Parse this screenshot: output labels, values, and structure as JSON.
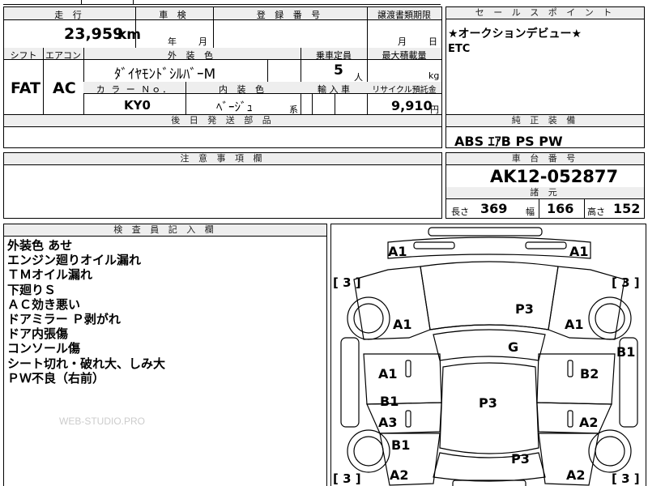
{
  "mileage": {
    "header": "走 行",
    "value": "23,959",
    "unit": "km"
  },
  "inspection": {
    "header": "車 検",
    "year_unit": "年",
    "month_unit": "月"
  },
  "registration": {
    "header": "登 録 番 号"
  },
  "transfer_docs": {
    "header": "譲渡書類期限",
    "month_unit": "月",
    "day_unit": "日"
  },
  "shift": {
    "header": "シフト",
    "value": "FAT"
  },
  "aircon": {
    "header": "エアコン",
    "value": "AC"
  },
  "exterior_color": {
    "header": "外 装 色",
    "value": "ﾀﾞｲﾔﾓﾝﾄﾞｼﾙﾊﾞｰM"
  },
  "capacity": {
    "header": "乗車定員",
    "value": "5",
    "unit": "人"
  },
  "max_load": {
    "header": "最大積載量",
    "unit": "kg"
  },
  "color_no": {
    "header": "カ ラ ー Ｎｏ．",
    "value": "KY0"
  },
  "interior_color": {
    "header": "内 装 色",
    "value": "ﾍﾞｰｼﾞｭ",
    "suffix": "系"
  },
  "import": {
    "header": "輸 入 車"
  },
  "recycle": {
    "header": "リサイクル預託金",
    "value": "9,910",
    "unit": "円"
  },
  "later_parts": {
    "header": "後 日 発 送 部 品"
  },
  "sales_point": {
    "header": "セ ー ル ス ポ イ ン ト",
    "line1": "★オークションデビュー★",
    "line2": "ETC"
  },
  "equipment": {
    "header": "純 正 装 備",
    "value": "ABS ｴｱB PS PW"
  },
  "caution": {
    "header": "注 意 事 項 欄"
  },
  "chassis": {
    "header": "車 台 番 号",
    "value": "AK12-052877"
  },
  "dimensions": {
    "header": "諸 元",
    "length_label": "長さ",
    "length": "369",
    "width_label": "幅",
    "width": "166",
    "height_label": "高さ",
    "height": "152"
  },
  "inspector": {
    "header": "検 査 員 記 入 欄",
    "notes": [
      "外装色 あせ",
      "エンジン廻りオイル漏れ",
      "ＴＭオイル漏れ",
      "下廻りＳ",
      "ＡＣ効き悪い",
      "ドアミラー Ｐ剥がれ",
      "ドア内張傷",
      "コンソール傷",
      "シート切れ・破れ大、しみ大",
      "ＰＷ不良（右前）"
    ]
  },
  "watermark": "WEB-STUDIO.PRO",
  "diagram": {
    "marks": [
      "A1",
      "A1",
      "A1",
      "A1",
      "P3",
      "G",
      "A1",
      "B2",
      "B1",
      "P3",
      "A3",
      "A2",
      "B1",
      "P3",
      "A2",
      "A2",
      "B1"
    ],
    "brackets": [
      "[ 3 ]",
      "[ 3 ]",
      "[ 3 ]",
      "[ 3 ]"
    ]
  }
}
